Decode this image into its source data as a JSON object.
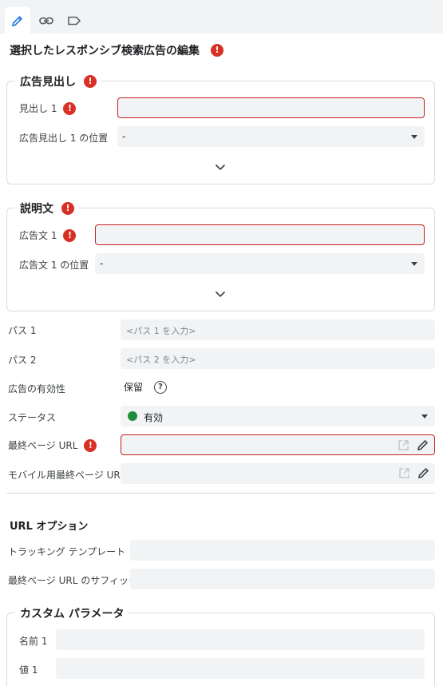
{
  "tabs": [
    {
      "icon": "pencil-icon",
      "active": true
    },
    {
      "icon": "link-icon",
      "active": false
    },
    {
      "icon": "label-icon",
      "active": false
    }
  ],
  "page": {
    "title": "選択したレスポンシブ検索広告の編集",
    "accent": "#1a73e8",
    "error_color": "#d93025"
  },
  "headlines": {
    "legend": "広告見出し",
    "headline_label": "見出し 1",
    "headline_value": "",
    "position_label": "広告見出し 1 の位置",
    "position_value": "-"
  },
  "descriptions": {
    "legend": "説明文",
    "description_label": "広告文 1",
    "description_value": "",
    "position_label": "広告文 1 の位置",
    "position_value": "-"
  },
  "path1": {
    "label": "パス 1",
    "placeholder": "<パス 1 を入力>"
  },
  "path2": {
    "label": "パス 2",
    "placeholder": "<パス 2 を入力>"
  },
  "ad_strength": {
    "label": "広告の有効性",
    "value": "保留"
  },
  "status": {
    "label": "ステータス",
    "value": "有効",
    "color": "#1e8e3e"
  },
  "final_url": {
    "label": "最終ページ URL",
    "value": ""
  },
  "mobile_url": {
    "label": "モバイル用最終ページ URL",
    "value": ""
  },
  "url_options": {
    "title": "URL オプション",
    "tracking_label": "トラッキング テンプレート",
    "suffix_label": "最終ページ URL のサフィックス"
  },
  "custom_params": {
    "legend": "カスタム パラメータ",
    "name_label": "名前 1",
    "value_label": "値 1"
  }
}
